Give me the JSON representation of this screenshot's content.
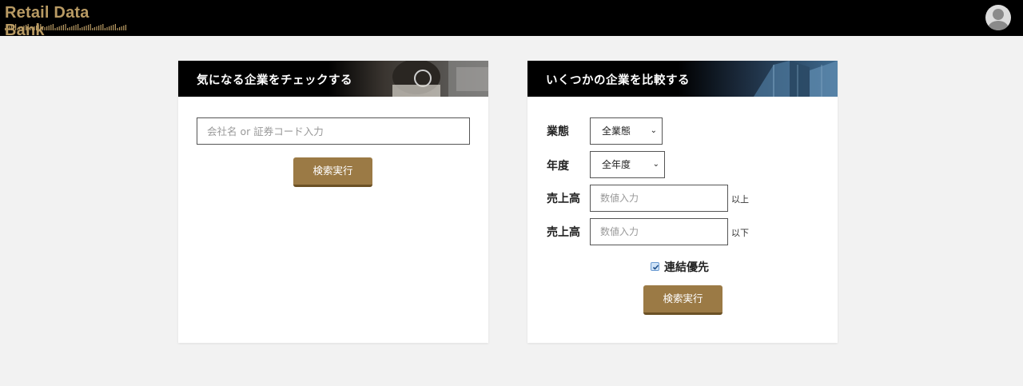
{
  "header": {
    "logo_text": "Retail Data Bank",
    "avatar_icon": "user-avatar-icon",
    "accent_color": "#b89a63"
  },
  "company_check": {
    "title": "気になる企業をチェックする",
    "search_placeholder": "会社名 or 証券コード入力",
    "search_button": "検索実行"
  },
  "compare": {
    "title": "いくつかの企業を比較する",
    "industry_label": "業態",
    "industry_selected": "全業態",
    "year_label": "年度",
    "year_selected": "全年度",
    "sales_min_label": "売上高",
    "sales_min_placeholder": "数値入力",
    "sales_min_suffix": "以上",
    "sales_max_label": "売上高",
    "sales_max_placeholder": "数値入力",
    "sales_max_suffix": "以下",
    "consolidated_label": "連結優先",
    "consolidated_checked": true,
    "search_button": "検索実行"
  },
  "colors": {
    "button_bg": "#9b7a45",
    "page_bg": "#f2f2f2"
  }
}
